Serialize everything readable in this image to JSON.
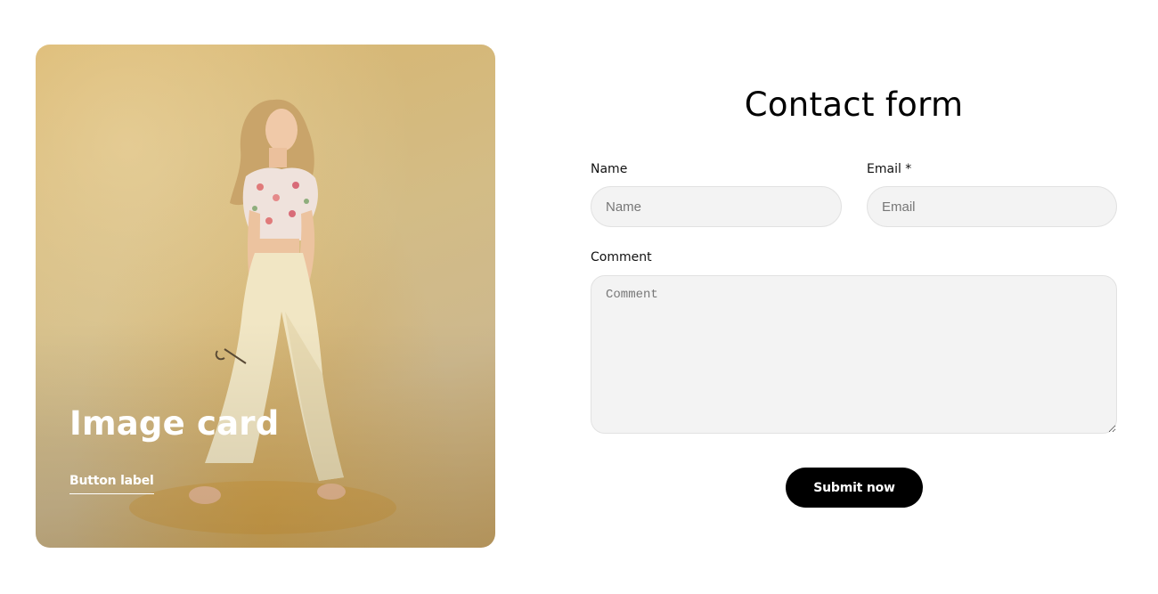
{
  "image_card": {
    "title": "Image card",
    "button_label": "Button label"
  },
  "contact_form": {
    "title": "Contact form",
    "name": {
      "label": "Name",
      "placeholder": "Name",
      "value": ""
    },
    "email": {
      "label": "Email *",
      "placeholder": "Email",
      "value": ""
    },
    "comment": {
      "label": "Comment",
      "placeholder": "Comment",
      "value": ""
    },
    "submit_label": "Submit now"
  },
  "colors": {
    "card_background": "#d3bc86",
    "input_background": "#f3f3f3",
    "button_background": "#000000",
    "button_text": "#ffffff"
  }
}
